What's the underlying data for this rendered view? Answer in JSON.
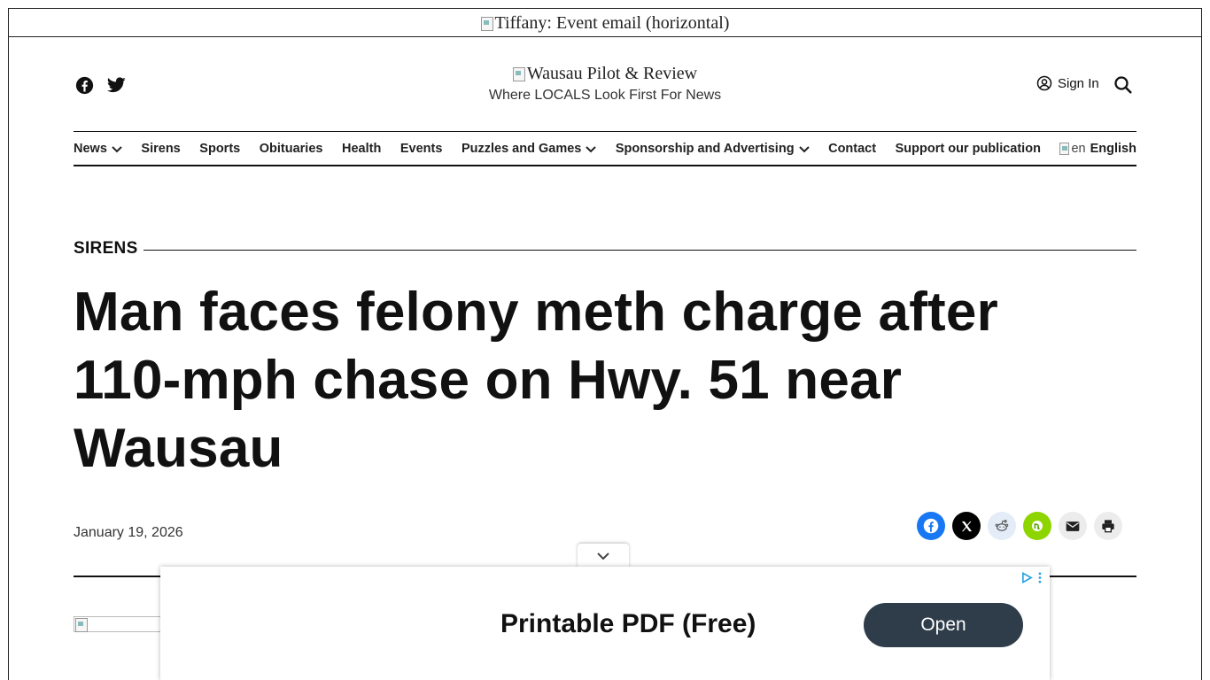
{
  "top_ad": {
    "alt_text": "Tiffany: Event email (horizontal)"
  },
  "header": {
    "logo_alt": "Wausau Pilot & Review",
    "tagline": "Where LOCALS Look First For News",
    "sign_in": "Sign In",
    "social": [
      "facebook-icon",
      "twitter-icon"
    ]
  },
  "nav": {
    "items": [
      {
        "label": "News",
        "dropdown": true
      },
      {
        "label": "Sirens",
        "dropdown": false
      },
      {
        "label": "Sports",
        "dropdown": false
      },
      {
        "label": "Obituaries",
        "dropdown": false
      },
      {
        "label": "Health",
        "dropdown": false
      },
      {
        "label": "Events",
        "dropdown": false
      },
      {
        "label": "Puzzles and Games",
        "dropdown": true
      },
      {
        "label": "Sponsorship and Advertising",
        "dropdown": true
      },
      {
        "label": "Contact",
        "dropdown": false
      },
      {
        "label": "Support our publication",
        "dropdown": false
      }
    ],
    "language": {
      "flag_alt": "en",
      "label": "English"
    }
  },
  "article": {
    "section": "SIRENS",
    "headline": "Man faces felony meth charge after 110-mph chase on Hwy. 51 near Wausau",
    "date": "January 19, 2026",
    "share": [
      "facebook-icon",
      "x-icon",
      "reddit-icon",
      "nextdoor-icon",
      "email-icon",
      "print-icon"
    ]
  },
  "anchor_ad": {
    "text": "Printable PDF (Free)",
    "button": "Open"
  },
  "colors": {
    "facebook": "#1877f2",
    "x": "#000000",
    "reddit": "#e3ecf7",
    "nextdoor": "#8ed500",
    "email": "#ececec",
    "print": "#ececec",
    "ad_button": "#2f3d4a"
  }
}
